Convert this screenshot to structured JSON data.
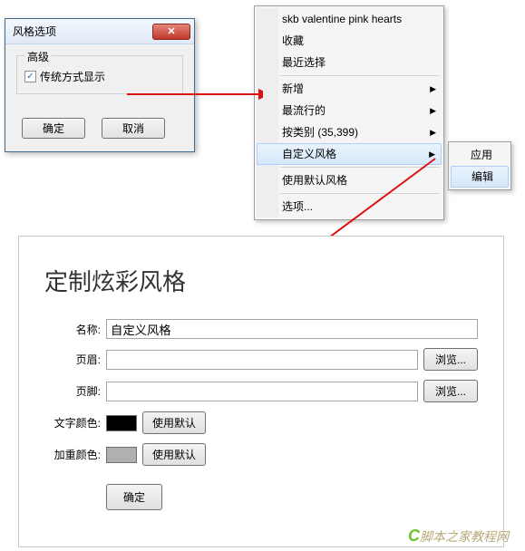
{
  "dialog": {
    "title": "风格选项",
    "close_icon": "✕",
    "group_title": "高级",
    "checkbox_checked": "✓",
    "checkbox_label": "传统方式显示",
    "ok": "确定",
    "cancel": "取消"
  },
  "menu": {
    "items": [
      "skb valentine pink hearts",
      "收藏",
      "最近选择"
    ],
    "items2": [
      "新增",
      "最流行的",
      "按类别 (35,399)",
      "自定义风格"
    ],
    "items3": [
      "使用默认风格"
    ],
    "items4": [
      "选项..."
    ],
    "arrow": "▶"
  },
  "submenu": {
    "apply": "应用",
    "edit": "编辑"
  },
  "panel": {
    "title": "定制炫彩风格",
    "name_label": "名称:",
    "name_value": "自定义风格",
    "header_label": "页眉:",
    "footer_label": "页脚:",
    "browse": "浏览...",
    "text_color_label": "文字颜色:",
    "accent_color_label": "加重颜色:",
    "use_default": "使用默认",
    "confirm": "确定",
    "colors": {
      "text": "#000000",
      "accent": "#b0b0b0"
    }
  },
  "watermark": {
    "c": "C",
    "text": "脚本之家教程网"
  }
}
